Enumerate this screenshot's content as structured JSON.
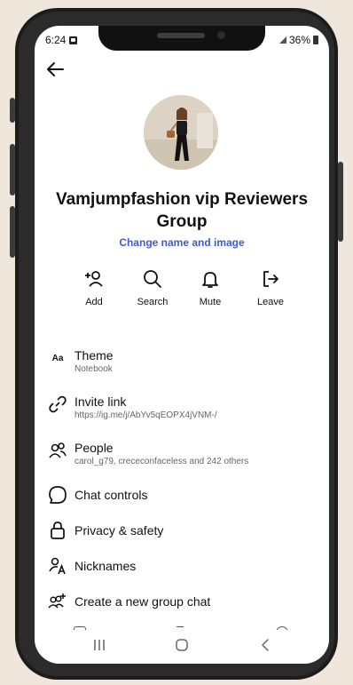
{
  "status_bar": {
    "time": "6:24",
    "battery": "36%"
  },
  "group": {
    "name": "Vamjumpfashion vip Reviewers Group",
    "change_link": "Change name and image"
  },
  "actions": [
    {
      "label": "Add",
      "icon": "add-person-icon"
    },
    {
      "label": "Search",
      "icon": "search-icon"
    },
    {
      "label": "Mute",
      "icon": "bell-icon"
    },
    {
      "label": "Leave",
      "icon": "leave-icon"
    }
  ],
  "menu": {
    "theme": {
      "title": "Theme",
      "subtitle": "Notebook",
      "icon_text": "Aa"
    },
    "invite": {
      "title": "Invite link",
      "subtitle": "https://ig.me/j/AbYv5qEOPX4jVNM-/"
    },
    "people": {
      "title": "People",
      "subtitle": "carol_g79, crececonfaceless and 242 others"
    },
    "chat_controls": {
      "title": "Chat controls"
    },
    "privacy": {
      "title": "Privacy & safety"
    },
    "nicknames": {
      "title": "Nicknames"
    },
    "new_group": {
      "title": "Create a new group chat"
    }
  },
  "colors": {
    "link": "#3b5bdb",
    "text": "#111111",
    "subtext": "#666666",
    "background": "#efe6dc"
  }
}
